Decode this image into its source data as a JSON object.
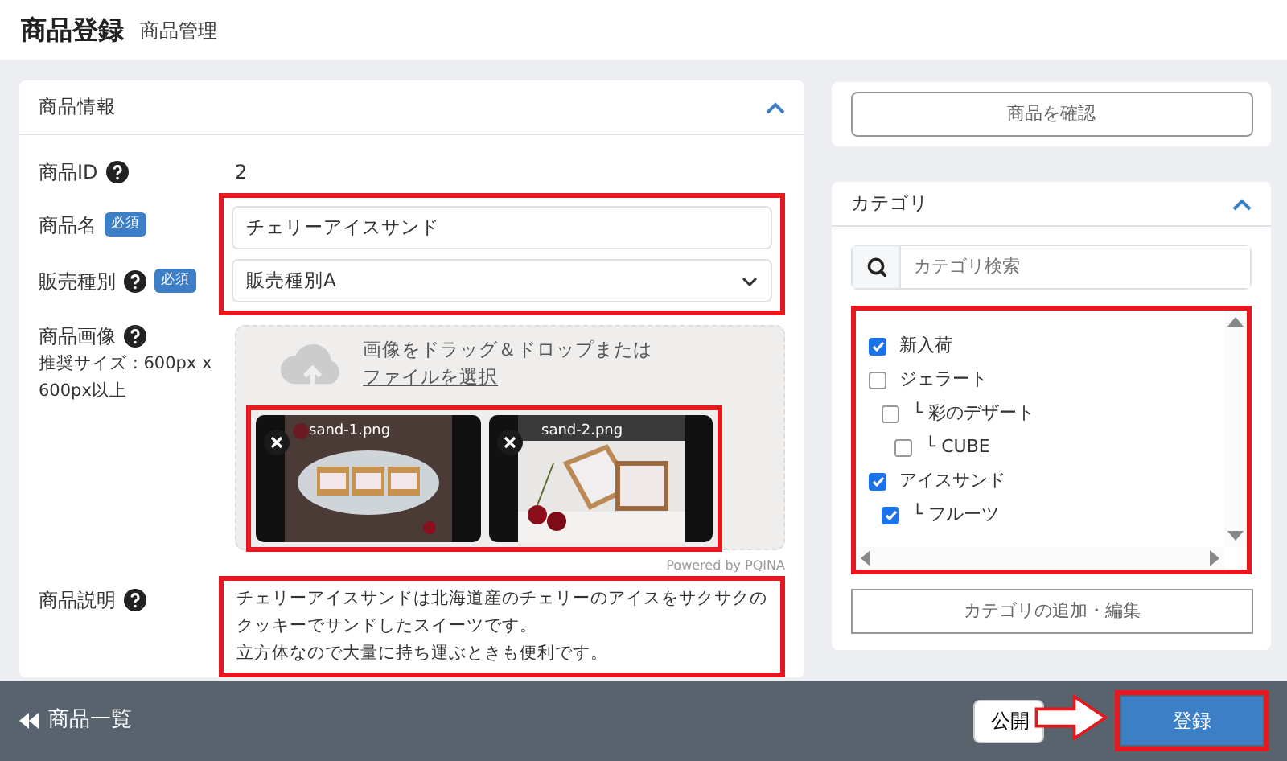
{
  "header": {
    "title": "商品登録",
    "subtitle": "商品管理"
  },
  "product_panel": {
    "title": "商品情報",
    "expanded": true,
    "fields": [
      {
        "kind": "text",
        "label": "商品ID",
        "help": true,
        "value": "2"
      },
      {
        "kind": "input",
        "label": "商品名",
        "help": false,
        "badge": "必須",
        "value": "チェリーアイスサンド"
      },
      {
        "kind": "select",
        "label": "販売種別",
        "help": true,
        "badge": "必須",
        "value": "販売種別A"
      }
    ],
    "image": {
      "label": "商品画像",
      "help": true,
      "note": "推奨サイズ : 600px x 600px以上",
      "drop_text": "画像をドラッグ＆ドロップまたは",
      "drop_link": "ファイルを選択",
      "files": [
        {
          "name": "sand-1.png",
          "kind": "picture"
        },
        {
          "name": "sand-2.png",
          "kind": "picture"
        }
      ],
      "credit": "Powered by PQINA"
    },
    "description": {
      "label": "商品説明",
      "help": true,
      "lines": [
        "チェリーアイスサンドは北海道産のチェリーのアイスをサクサクのクッキーでサンドしたスイーツです。",
        "立方体なので大量に持ち運ぶときも便利です。"
      ]
    }
  },
  "confirm_button": "商品を確認",
  "category_panel": {
    "title": "カテゴリ",
    "expanded": true,
    "search": {
      "placeholder": "カテゴリ検索"
    },
    "tree": [
      {
        "label": "新入荷",
        "checked": true
      },
      {
        "label": "ジェラート",
        "checked": false,
        "children": [
          {
            "label": "└ 彩のデザート",
            "checked": false,
            "children": [
              {
                "label": "└ CUBE",
                "checked": false
              }
            ]
          }
        ]
      },
      {
        "label": "アイスサンド",
        "checked": true,
        "children": [
          {
            "label": "└ フルーツ",
            "checked": true
          }
        ]
      }
    ],
    "edit_button": "カテゴリの追加・編集"
  },
  "footer": {
    "back_link": "商品一覧",
    "publish_button": "公開",
    "submit_button": "登録"
  }
}
